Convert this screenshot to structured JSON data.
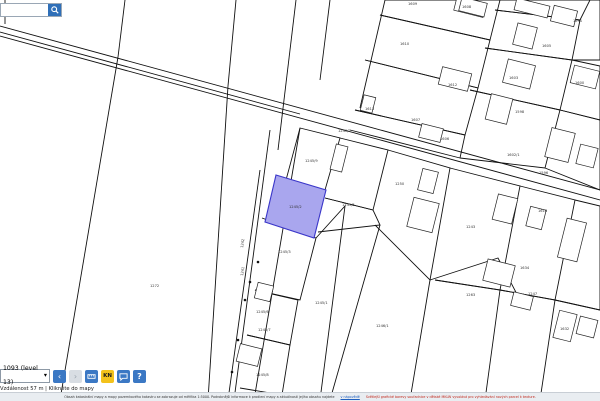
{
  "search": {
    "placeholder": "",
    "value": ""
  },
  "toolbar": {
    "scale_value": "1093 (level 13)",
    "prev_label": "‹",
    "next_label": "›",
    "kn_label": "KN",
    "help_label": "?"
  },
  "scalebar": {
    "text": "Vzdálenost 57 m | Klikněte do mapy"
  },
  "footer": {
    "text1": "Obsah katastrální mapy a mapy pozemkového katastru se zobrazuje od měřítka 1:5000. Podrobnější informace k prodlení mapy a aktuálnosti jejího obsahu najdete",
    "link": "v nápovědě",
    "text2": "Světlejší grafické barevy souřadnice v dětské MKLW vyvolává pro vyhledávání nových parcel k texture."
  },
  "parcels": {
    "p1": "1272",
    "p2": "1242",
    "p3": "1275",
    "p4": "1241",
    "p5": "1245/2",
    "p6": "1245/3",
    "p7": "1245/1",
    "p8": "1245/6",
    "p9": "1245/7",
    "p10": "1245/8",
    "p11": "1245/9",
    "p12": "1245/5",
    "p13": "1246/1",
    "p14": "1240/2",
    "p15": "1240/1",
    "p16": "1255",
    "p17": "1272",
    "p18": "1243",
    "p19": "1263",
    "p20": "1247",
    "p21": "1261",
    "p22": "1262",
    "p23": "1264",
    "p24": "1610",
    "p25": "1609",
    "p26": "1608",
    "p27": "1607",
    "p28": "1612",
    "p29": "1611",
    "p30": "1606",
    "p31": "1250",
    "p32": "1602/1",
    "p33": "1603",
    "p34": "1604",
    "p35": "1605",
    "p36": "1601",
    "p37": "1598",
    "p38": "1597",
    "p39": "1595",
    "p40": "1594",
    "p41": "1593",
    "p42": "1592",
    "p43": "1591",
    "p44": "1600",
    "p45": "1599",
    "p46": "1596",
    "p47": "1613",
    "p48": "1614",
    "p49": "1615",
    "p50": "1616",
    "p51": "1630",
    "p52": "1632",
    "p53": "1634",
    "p54": "1636"
  },
  "colors": {
    "highlight_fill": "#a9a6ee",
    "highlight_stroke": "#3a36c9",
    "search_button": "#2f6fb8",
    "nav_active": "#3b78c4",
    "kn_button": "#f3c21b"
  }
}
